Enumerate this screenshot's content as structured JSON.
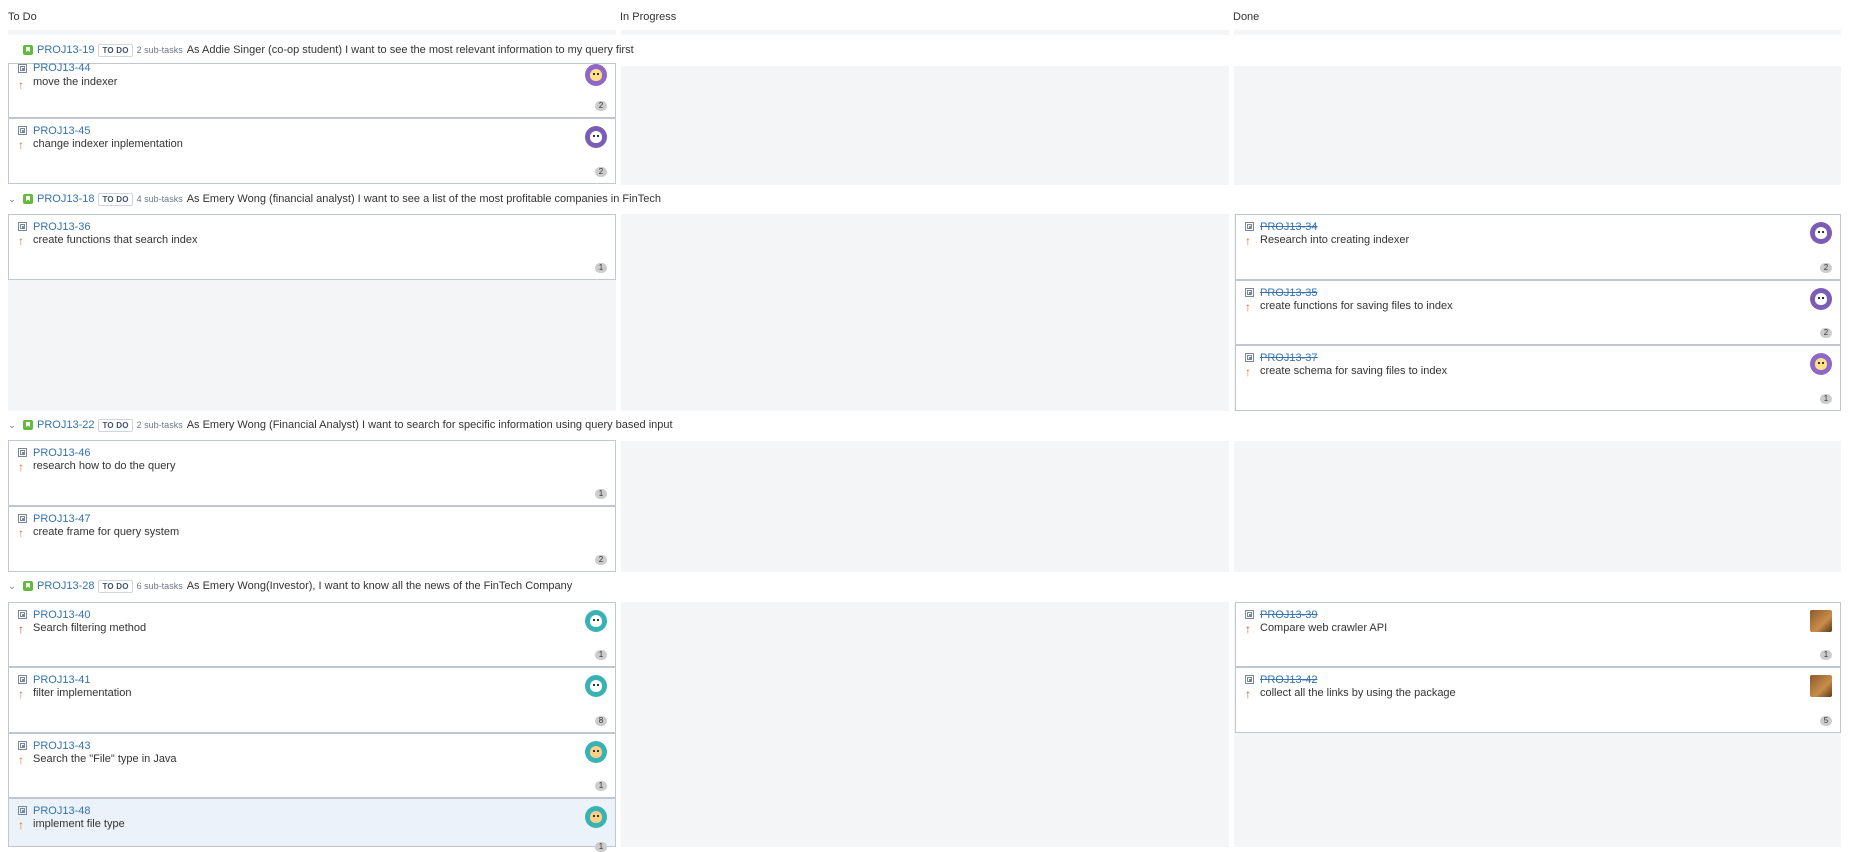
{
  "columns": [
    {
      "title": "To Do"
    },
    {
      "title": "In Progress"
    },
    {
      "title": "Done"
    }
  ],
  "colors": {
    "accent": "#3572b0",
    "story": "#63ba3c",
    "column_bg": "#f4f5f7"
  },
  "swimlanes": [
    {
      "key": "PROJ13-19",
      "status": "TO DO",
      "subtasks": "2 sub-tasks",
      "summary": "As Addie Singer (co-op student) I want to see the most relevant information to my query first",
      "todo": [
        {
          "key": "PROJ13-44",
          "summary": "move the indexer",
          "count": "2",
          "avatar": "user-avatar-icon"
        },
        {
          "key": "PROJ13-45",
          "summary": "change indexer inplementation",
          "count": "2",
          "avatar": "user-avatar-icon"
        }
      ]
    },
    {
      "key": "PROJ13-18",
      "status": "TO DO",
      "subtasks": "4 sub-tasks",
      "summary": "As Emery Wong (financial analyst) I want to see a list of the most profitable companies in FinTech",
      "todo": [
        {
          "key": "PROJ13-36",
          "summary": "create functions that search index",
          "count": "1"
        }
      ],
      "done": [
        {
          "key": "PROJ13-34",
          "summary": "Research into creating indexer",
          "count": "2"
        },
        {
          "key": "PROJ13-35",
          "summary": "create functions for saving files to index",
          "count": "2"
        },
        {
          "key": "PROJ13-37",
          "summary": "create schema for saving files to index",
          "count": "1"
        }
      ]
    },
    {
      "key": "PROJ13-22",
      "status": "TO DO",
      "subtasks": "2 sub-tasks",
      "summary": "As Emery Wong (Financial Analyst) I want to search for specific information using query based input",
      "todo": [
        {
          "key": "PROJ13-46",
          "summary": "research how to do the query",
          "count": "1"
        },
        {
          "key": "PROJ13-47",
          "summary": "create frame for query system",
          "count": "2"
        }
      ]
    },
    {
      "key": "PROJ13-28",
      "status": "TO DO",
      "subtasks": "6 sub-tasks",
      "summary": "As Emery Wong(Investor), I want to know all the news of the FinTech Company",
      "todo": [
        {
          "key": "PROJ13-40",
          "summary": "Search filtering method",
          "count": "1"
        },
        {
          "key": "PROJ13-41",
          "summary": "filter implementation",
          "count": "8"
        },
        {
          "key": "PROJ13-43",
          "summary": "Search the \"File\" type in Java",
          "count": "1"
        },
        {
          "key": "PROJ13-48",
          "summary": "implement file type",
          "count": "1"
        }
      ],
      "done": [
        {
          "key": "PROJ13-39",
          "summary": "Compare web crawler API",
          "count": "1"
        },
        {
          "key": "PROJ13-42",
          "summary": "collect all the links by using the package",
          "count": "5"
        }
      ]
    }
  ]
}
